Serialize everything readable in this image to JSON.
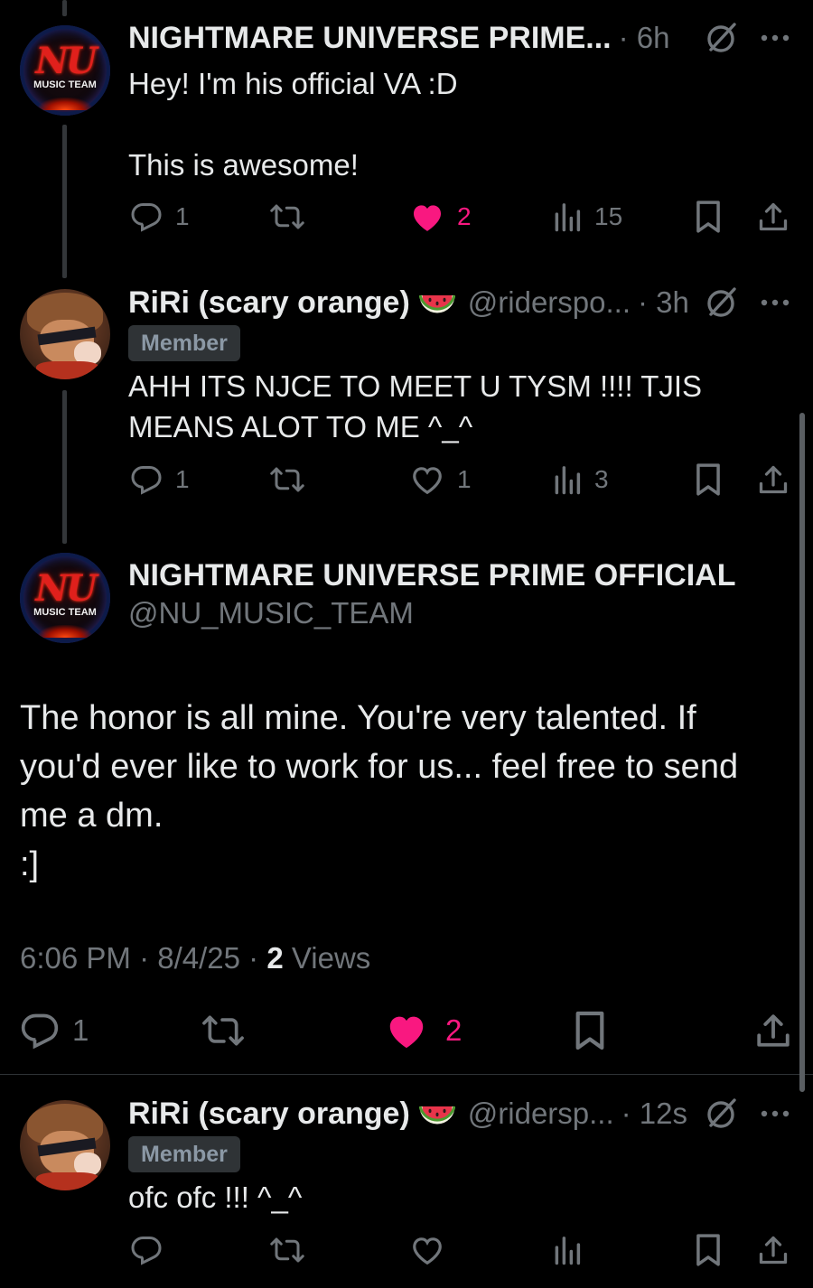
{
  "posts": [
    {
      "author": "NIGHTMARE UNIVERSE PRIME...",
      "time": "· 6h",
      "text": "Hey! I'm his official VA :D\n\nThis is awesome!",
      "avatar_text": "NU",
      "avatar_subtext": "MUSIC TEAM",
      "replies": "1",
      "likes": "2",
      "liked": true,
      "views": "15"
    },
    {
      "author": "RiRi (scary orange)",
      "emoji": "watermelon",
      "handle": "@riderspo...",
      "time": "· 3h",
      "badge": "Member",
      "text": "AHH ITS NJCE TO MEET U TYSM !!!! TJIS\nMEANS ALOT TO ME ^_^",
      "replies": "1",
      "likes": "1",
      "liked": false,
      "views": "3"
    }
  ],
  "focused_post": {
    "author": "NIGHTMARE UNIVERSE PRIME OFFICIAL",
    "handle": "@NU_MUSIC_TEAM",
    "avatar_text": "NU",
    "avatar_subtext": "MUSIC TEAM",
    "text": "The honor is all mine. You're very talented. If\nyou'd ever like to work for us... feel free to send\nme a dm.\n:]",
    "time": "6:06 PM",
    "date": "8/4/25",
    "views_count": "2",
    "views_label": "Views",
    "replies": "1",
    "likes": "2",
    "liked": true
  },
  "reply": {
    "author": "RiRi (scary orange)",
    "emoji": "watermelon",
    "handle": "@ridersp...",
    "time": "· 12s",
    "badge": "Member",
    "text": "ofc ofc !!! ^_^"
  },
  "colors": {
    "background": "#000000",
    "text": "#e7e9ea",
    "muted": "#71767b",
    "like": "#f91880",
    "divider": "#2f3336",
    "badge_bg": "#2f3336",
    "badge_text": "#8b98a5"
  },
  "icons": [
    "grok-icon",
    "more-icon",
    "reply-icon",
    "retweet-icon",
    "heart-icon",
    "views-icon",
    "bookmark-icon",
    "share-icon"
  ]
}
